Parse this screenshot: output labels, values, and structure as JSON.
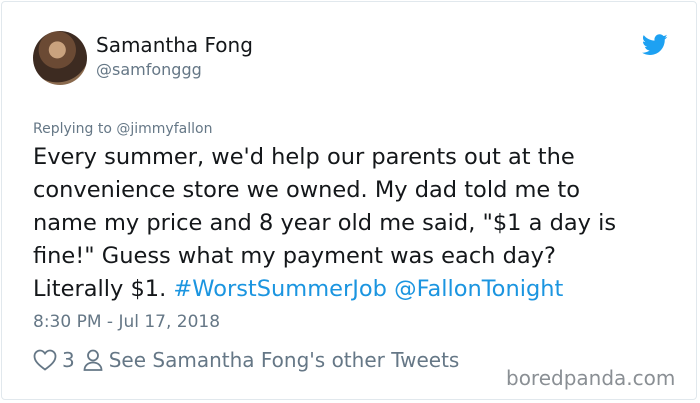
{
  "author": {
    "name": "Samantha Fong",
    "handle": "@samfonggg"
  },
  "reply": {
    "text": "Replying to @jimmyfallon"
  },
  "tweet": {
    "line1": "Every summer, we'd help our parents out at the",
    "line2": "convenience store we owned. My dad told me to",
    "line3": "name my price and 8 year old me said, \"$1 a day is",
    "line4": "fine!\" Guess what my payment was each day?",
    "line5_prefix": "Literally $1. ",
    "hashtag": "#WorstSummerJob",
    "mention": "@FallonTonight"
  },
  "timestamp": "8:30 PM - Jul 17, 2018",
  "footer": {
    "likes": "3",
    "other_tweets_label": "See Samantha Fong's other Tweets"
  },
  "watermark": "boredpanda.com",
  "colors": {
    "link": "#1b95e0",
    "secondary_text": "#657786",
    "bird": "#1da1f2"
  },
  "icons": {
    "logo": "twitter-bird-icon",
    "like": "heart-icon",
    "profile": "person-icon"
  }
}
